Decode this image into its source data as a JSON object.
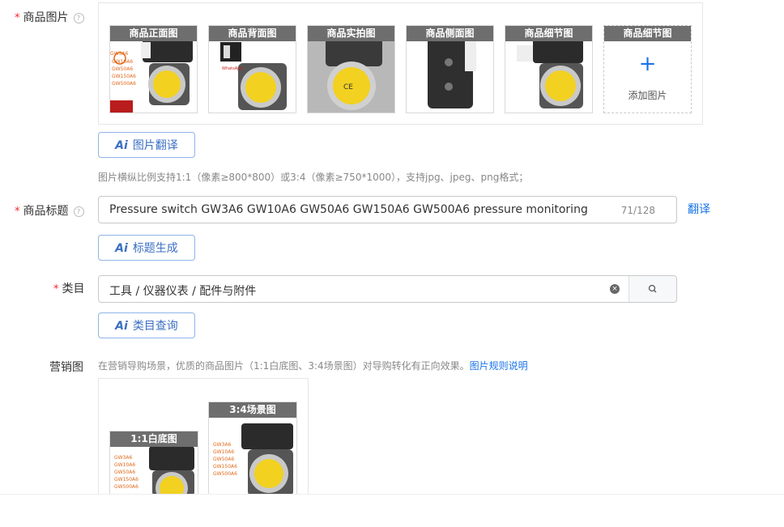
{
  "product_images": {
    "label": "商品图片",
    "help_icon": "question-circle-icon",
    "thumbnails": [
      {
        "title": "商品正面图"
      },
      {
        "title": "商品背面图"
      },
      {
        "title": "商品实拍图"
      },
      {
        "title": "商品侧面图"
      },
      {
        "title": "商品细节图"
      }
    ],
    "add_slot": {
      "title": "商品细节图",
      "add_label": "添加图片",
      "icon": "plus-icon"
    },
    "translate_button": "图片翻译",
    "hint": "图片横纵比例支持1:1（像素≥800*800）或3:4（像素≥750*1000），支持jpg、jpeg、png格式；"
  },
  "product_title": {
    "label": "商品标题",
    "value": "Pressure switch GW3A6 GW10A6 GW50A6 GW150A6 GW500A6 pressure monitoring",
    "counter": "71/128",
    "translate_link": "翻译",
    "generate_button": "标题生成"
  },
  "category": {
    "label": "类目",
    "value": "工具 / 仪器仪表 / 配件与附件",
    "clear_icon": "clear-circle-icon",
    "search_icon": "search-icon",
    "query_button": "类目查询"
  },
  "marketing": {
    "label": "营销图",
    "hint": "在营销导购场景，优质的商品图片（1:1白底图、3:4场景图）对导购转化有正向效果。",
    "rules_link": "图片规则说明",
    "images": [
      {
        "title": "1:1白底图"
      },
      {
        "title": "3:4场景图"
      }
    ]
  },
  "product_photo_texts": [
    "GW3A6",
    "GW10A6",
    "GW50A6",
    "GW150A6",
    "GW500A6"
  ],
  "colors": {
    "accent": "#1a73e8",
    "required": "#f5222d",
    "thumb_title_bg": "#6e6e6e"
  }
}
